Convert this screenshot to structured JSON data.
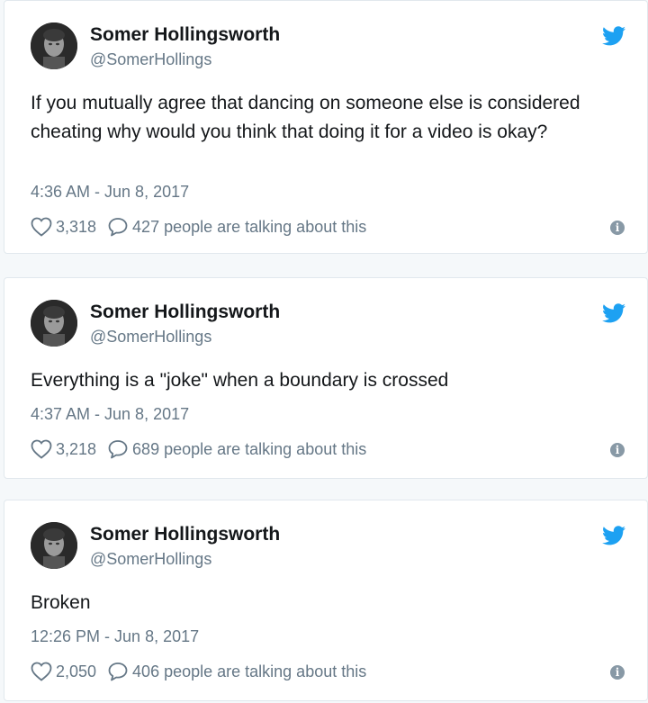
{
  "colors": {
    "twitter_blue": "#1da1f2",
    "secondary_text": "#657786",
    "primary_text": "#14171a",
    "card_border": "#e1e8ed"
  },
  "icons": {
    "brand": "twitter-bird-icon",
    "like": "heart-icon",
    "reply": "speech-bubble-icon",
    "info": "info-icon"
  },
  "tweets": [
    {
      "name": "Somer Hollingsworth",
      "handle": "@SomerHollings",
      "text": "If you mutually agree that dancing on someone else is considered cheating why would you think that doing it for a video is okay?",
      "time": "4:36 AM - Jun 8, 2017",
      "likes": "3,318",
      "talking": "427 people are talking about this"
    },
    {
      "name": "Somer Hollingsworth",
      "handle": "@SomerHollings",
      "text": "Everything is a \"joke\" when a boundary is crossed",
      "time": "4:37 AM - Jun 8, 2017",
      "likes": "3,218",
      "talking": "689 people are talking about this"
    },
    {
      "name": "Somer Hollingsworth",
      "handle": "@SomerHollings",
      "text": "Broken",
      "time": "12:26 PM - Jun 8, 2017",
      "likes": "2,050",
      "talking": "406 people are talking about this"
    }
  ]
}
